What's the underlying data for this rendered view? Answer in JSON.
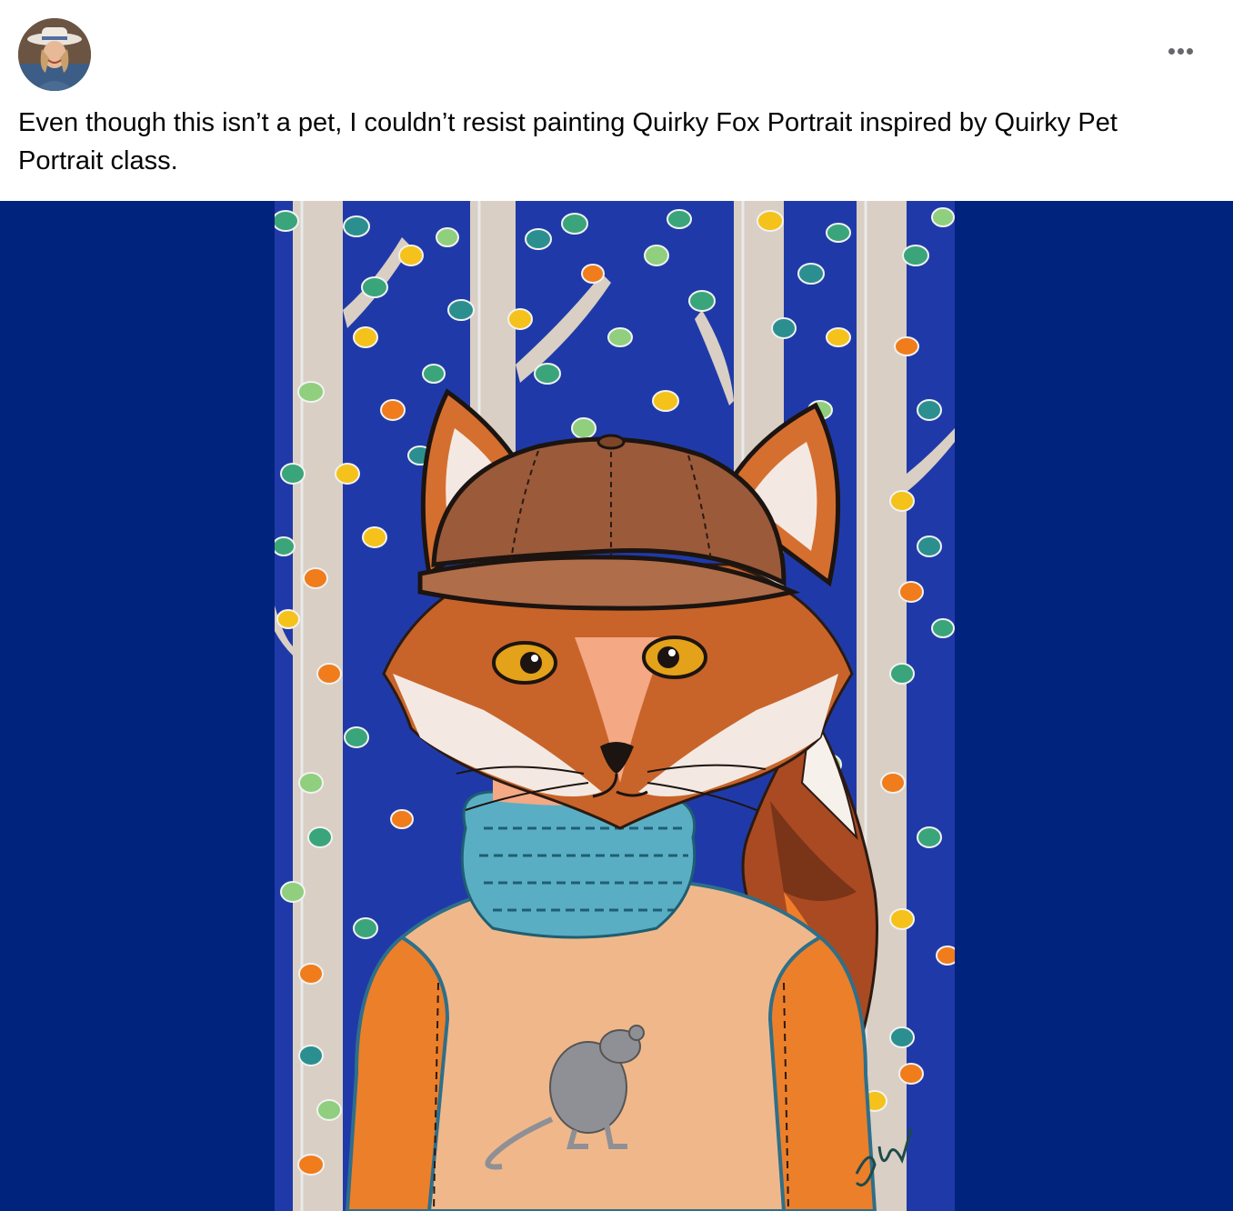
{
  "post": {
    "author_avatar_icon": "author-avatar",
    "more_icon": "more-options-icon",
    "text": "Even though this isn’t a pet, I couldn’t resist painting Quirky Fox Portrait inspired by Quirky Pet Portrait class."
  },
  "media": {
    "background_color": "#00237d",
    "artwork_subject": "fox-portrait-painting",
    "colors": {
      "sky": "#1f3aa8",
      "trunk": "#d9cfc4",
      "fox": "#c8642a",
      "hat": "#9b5a3a",
      "scarf": "#5aaec4",
      "sweater": "#f0b88a",
      "sleeve": "#ec7f2a"
    }
  }
}
